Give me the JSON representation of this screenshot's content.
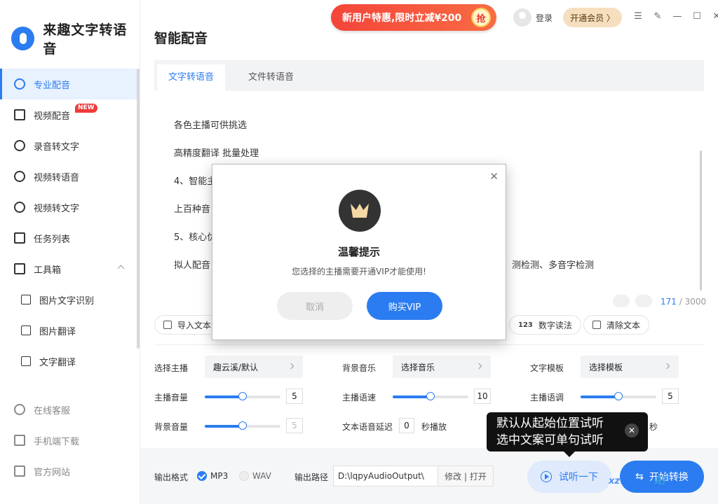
{
  "app": {
    "name": "来趣文字转语音"
  },
  "header": {
    "page_title": "智能配音",
    "promo": "新用户特惠,限时立减¥200",
    "promo_grab": "抢",
    "login": "登录",
    "vip": "开通会员 〉"
  },
  "sidebar": {
    "items": [
      {
        "label": "专业配音"
      },
      {
        "label": "视频配音",
        "badge": "NEW"
      },
      {
        "label": "录音转文字"
      },
      {
        "label": "视频转语音"
      },
      {
        "label": "视频转文字"
      },
      {
        "label": "任务列表"
      },
      {
        "label": "工具箱"
      }
    ],
    "sub_items": [
      {
        "label": "图片文字识别"
      },
      {
        "label": "图片翻译"
      },
      {
        "label": "文字翻译"
      }
    ],
    "bottom": [
      {
        "label": "在线客服"
      },
      {
        "label": "手机端下载"
      },
      {
        "label": "官方网站"
      }
    ]
  },
  "tabs": [
    {
      "label": "文字转语音"
    },
    {
      "label": "文件转语音"
    }
  ],
  "editor": {
    "lines": [
      "各色主播可供挑选",
      "高精度翻译 批量处理",
      "4、智能主",
      "上百种音",
      "5、核心优",
      "拟人配音",
      "测检测、多音字检测"
    ],
    "count": "171",
    "max": "/ 3000"
  },
  "toolbar": {
    "import": "导入文本",
    "digits": "数字读法",
    "digits_icon": "123",
    "clear": "清除文本"
  },
  "settings": {
    "anchor_label": "选择主播",
    "anchor_value": "趣云溪/默认",
    "bgm_label": "背景音乐",
    "bgm_value": "选择音乐",
    "template_label": "文字模板",
    "template_value": "选择模板",
    "anchor_volume_label": "主播音量",
    "anchor_volume": "5",
    "anchor_volume_level": 0.5,
    "speed_label": "主播语速",
    "speed": "10",
    "speed_level": 0.5,
    "pitch_label": "主播语调",
    "pitch": "5",
    "pitch_level": 0.5,
    "bg_volume_label": "背景音量",
    "bg_volume": "5",
    "bg_volume_level": 0.5,
    "delay_label": "文本语音延迟",
    "delay": "0",
    "delay_unit": "秒播放",
    "tail_unit": "秒"
  },
  "footer": {
    "format_label": "输出格式",
    "mp3": "MP3",
    "wav": "WAV",
    "path_label": "输出路径",
    "path": "D:\\lqpyAudioOutput\\",
    "path_actions": "修改 | 打开",
    "try": "试听一下",
    "start": "开始转换"
  },
  "tooltip": {
    "line1": "默认从起始位置试听",
    "line2": "选中文案可单句试听"
  },
  "modal": {
    "title": "温馨提示",
    "message": "您选择的主播需要开通VIP才能使用!",
    "cancel": "取消",
    "buy": "购买VIP"
  },
  "watermark": {
    "text": "xz7.com",
    "big": "站"
  },
  "colors": {
    "accent": "#2b7cf0",
    "promo": "#f4453a",
    "vip": "#f6dfbe"
  }
}
